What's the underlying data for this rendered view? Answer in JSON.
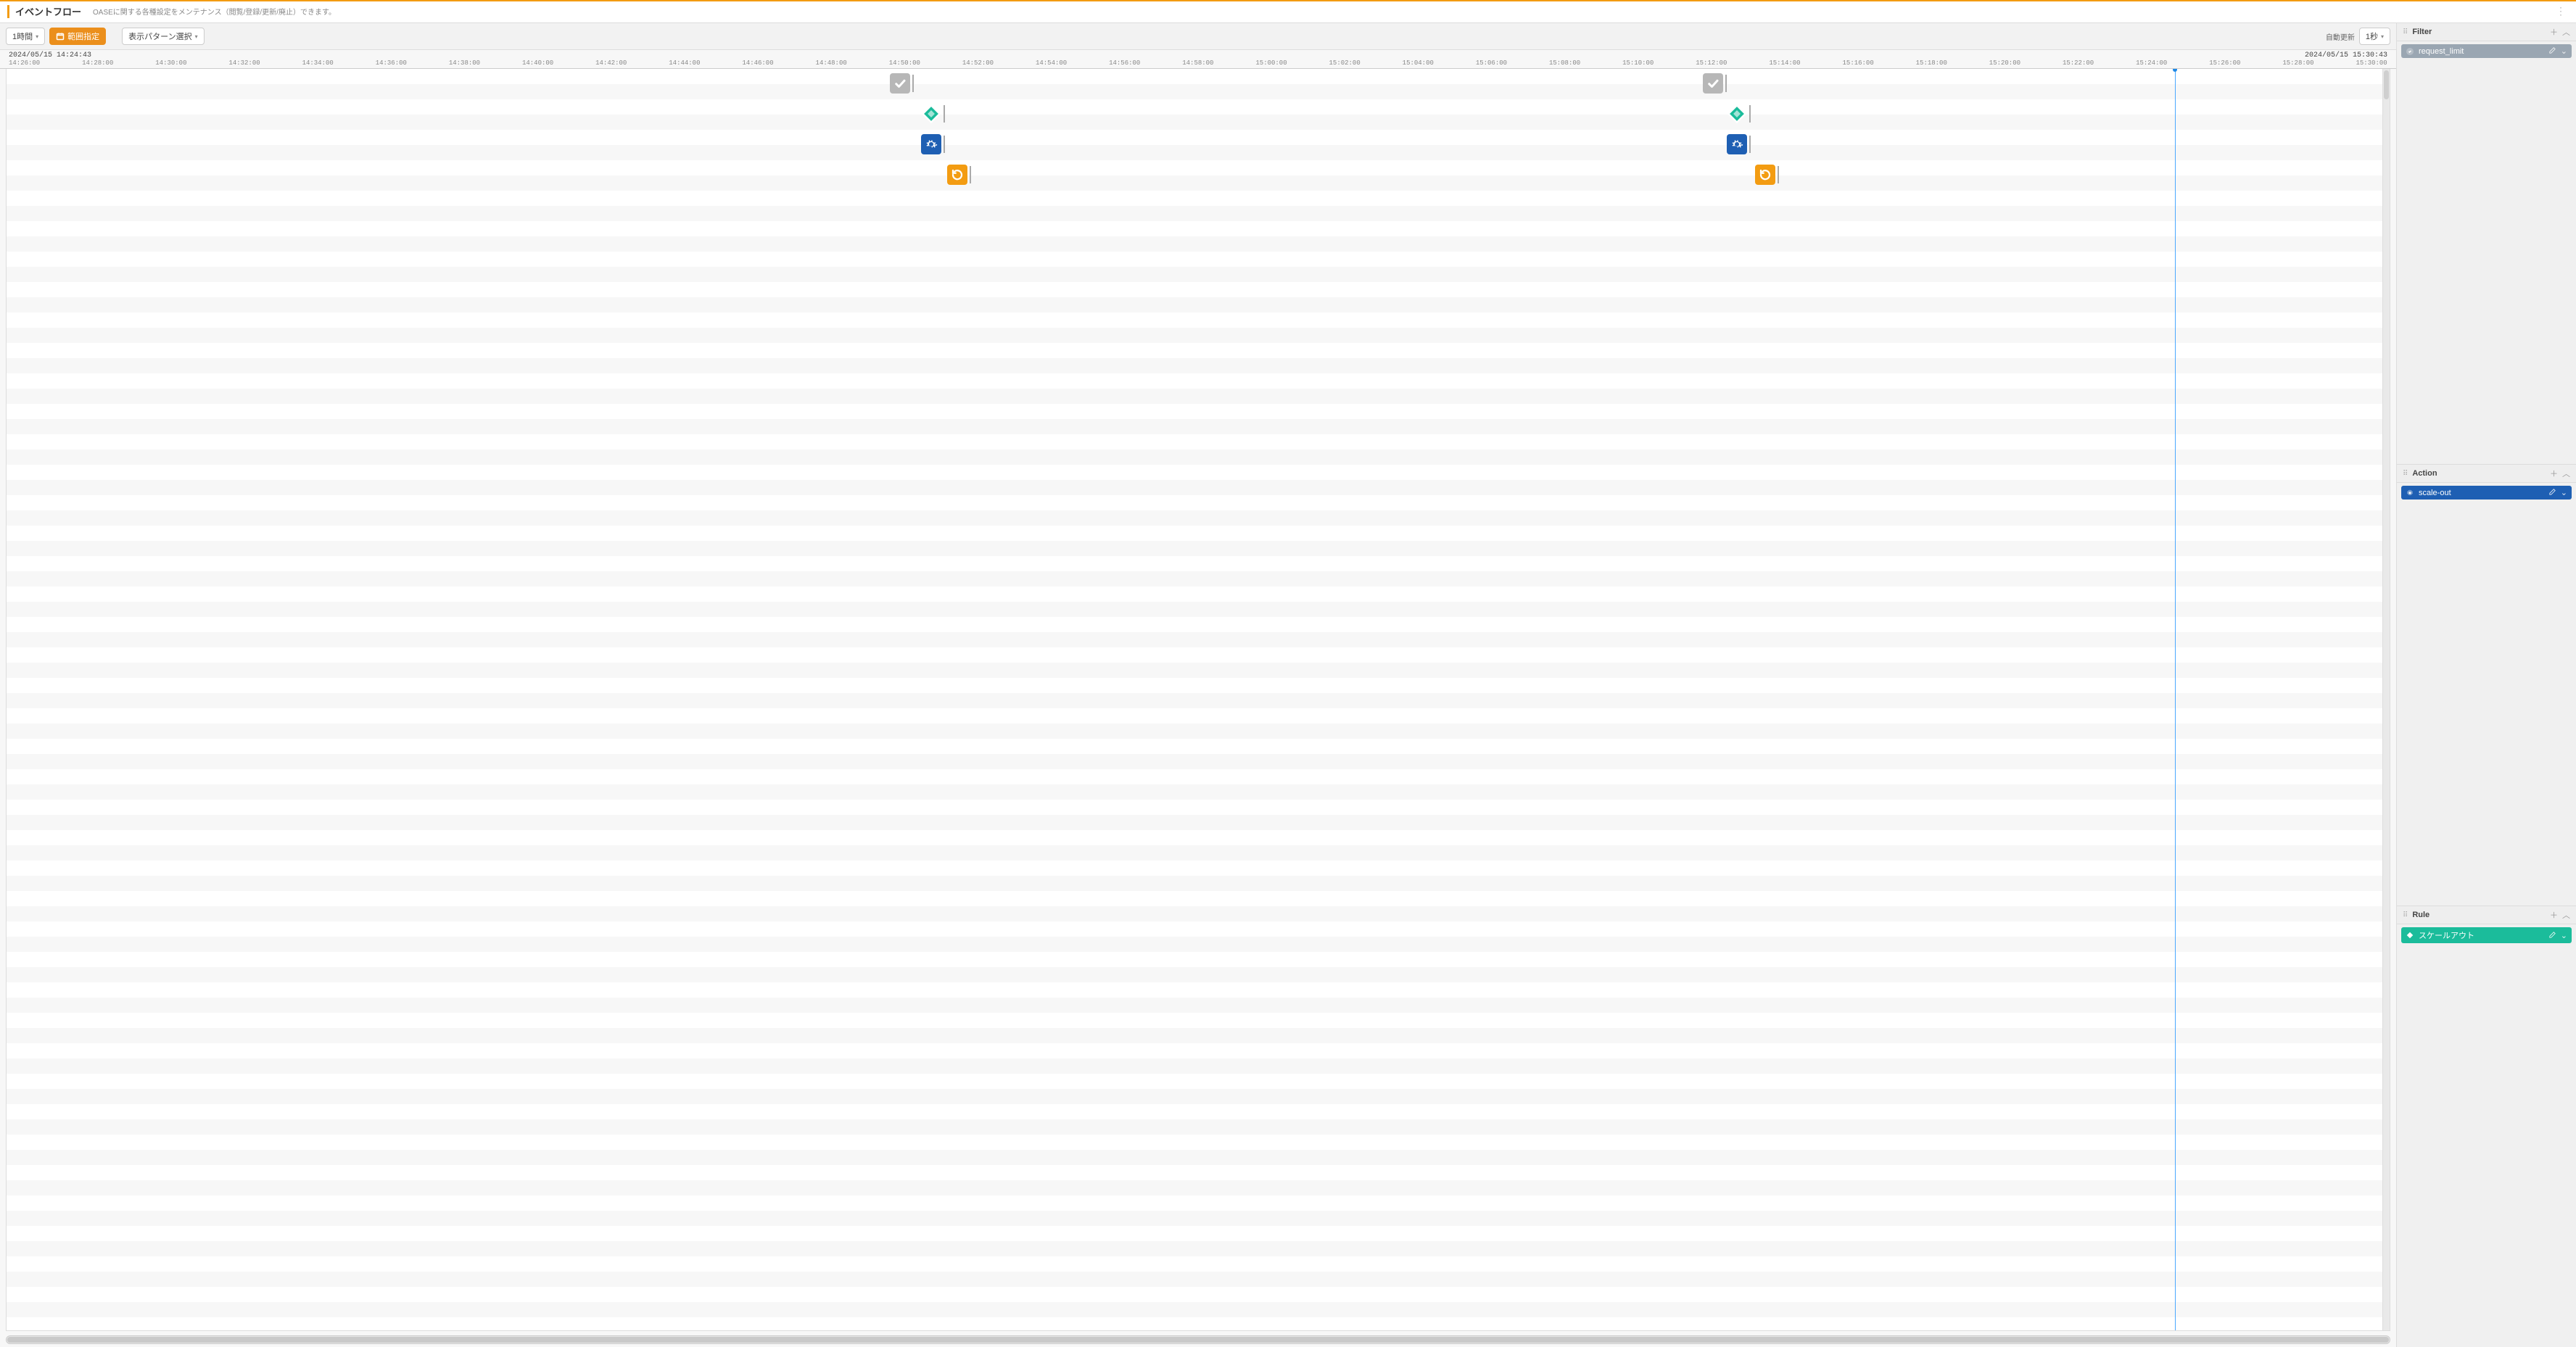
{
  "header": {
    "title": "イベントフロー",
    "subtitle": "OASEに関する各種設定をメンテナンス（閲覧/登録/更新/廃止）できます。"
  },
  "toolbar": {
    "range_button": "1時間",
    "range_mode_button": "範囲指定",
    "pattern_select": "表示パターン選択",
    "auto_refresh_label": "自動更新",
    "auto_refresh_value": "1秒"
  },
  "timeline": {
    "range_start": "2024/05/15 14:24:43",
    "range_end": "2024/05/15 15:30:43",
    "now_pct": 91.0,
    "ticks": [
      "14:26:00",
      "14:28:00",
      "14:30:00",
      "14:32:00",
      "14:34:00",
      "14:36:00",
      "14:38:00",
      "14:40:00",
      "14:42:00",
      "14:44:00",
      "14:46:00",
      "14:48:00",
      "14:50:00",
      "14:52:00",
      "14:54:00",
      "14:56:00",
      "14:58:00",
      "15:00:00",
      "15:02:00",
      "15:04:00",
      "15:06:00",
      "15:08:00",
      "15:10:00",
      "15:12:00",
      "15:14:00",
      "15:16:00",
      "15:18:00",
      "15:20:00",
      "15:22:00",
      "15:24:00",
      "15:26:00",
      "15:28:00",
      "15:30:00"
    ],
    "events": [
      {
        "row": 0,
        "x_pct": 37.5,
        "kind": "check",
        "name": "event-check-1"
      },
      {
        "row": 1,
        "x_pct": 38.8,
        "kind": "rule",
        "name": "event-rule-1"
      },
      {
        "row": 2,
        "x_pct": 38.8,
        "kind": "action",
        "name": "event-action-1"
      },
      {
        "row": 3,
        "x_pct": 39.9,
        "kind": "retry",
        "name": "event-retry-1"
      },
      {
        "row": 0,
        "x_pct": 71.6,
        "kind": "check",
        "name": "event-check-2"
      },
      {
        "row": 1,
        "x_pct": 72.6,
        "kind": "rule",
        "name": "event-rule-2"
      },
      {
        "row": 2,
        "x_pct": 72.6,
        "kind": "action",
        "name": "event-action-2"
      },
      {
        "row": 3,
        "x_pct": 73.8,
        "kind": "retry",
        "name": "event-retry-2"
      }
    ]
  },
  "panels": {
    "filter": {
      "title": "Filter",
      "items": [
        {
          "label": "request_limit"
        }
      ]
    },
    "action": {
      "title": "Action",
      "items": [
        {
          "label": "scale-out"
        }
      ]
    },
    "rule": {
      "title": "Rule",
      "items": [
        {
          "label": "スケールアウト"
        }
      ]
    }
  }
}
